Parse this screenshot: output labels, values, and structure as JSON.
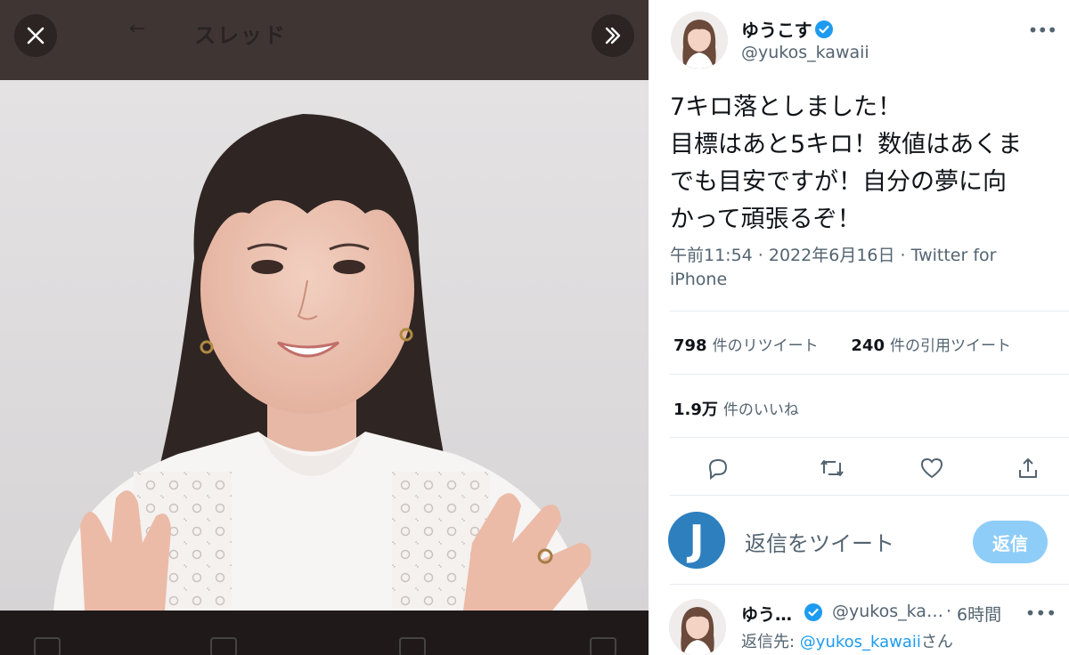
{
  "viewer": {
    "title": "スレッド",
    "back_icon": "arrow-left-icon",
    "close_icon": "close-icon",
    "expand_icon": "chevron-double-right-icon",
    "photo_alt": "photo",
    "bg_color": "#3f3634"
  },
  "tweet": {
    "author": {
      "name": "ゆうこす",
      "handle": "@yukos_kawaii",
      "verified": true
    },
    "text_lines": [
      "7キロ落としました！",
      "目標はあと5キロ！数値はあくま",
      "でも目安ですが！自分の夢に向",
      "かって頑張るぞ！"
    ],
    "meta_line1": "午前11:54 · 2022年6月16日 · Twitter for",
    "meta_line2": "iPhone",
    "stats": {
      "retweets_count": "798",
      "retweets_label": "件のリツイート",
      "quotes_count": "240",
      "quotes_label": "件の引用ツイート",
      "likes_count": "1.9万",
      "likes_label": "件のいいね"
    },
    "actions": [
      "reply-icon",
      "retweet-icon",
      "like-icon",
      "share-icon"
    ]
  },
  "reply_box": {
    "avatar_letter": "J",
    "placeholder": "返信をツイート",
    "button_label": "返信"
  },
  "reply": {
    "name": "ゆう…",
    "handle": "@yukos_ka…",
    "dot": "·",
    "time": "6時間",
    "reply_to_prefix": "返信先: ",
    "reply_to_mention": "@yukos_kawaii",
    "reply_to_suffix": "さん"
  },
  "colors": {
    "accent": "#1d9bf0",
    "reply_button": "#8ecdf8",
    "muted_text": "#536471",
    "j_avatar": "#2d7fbe"
  }
}
